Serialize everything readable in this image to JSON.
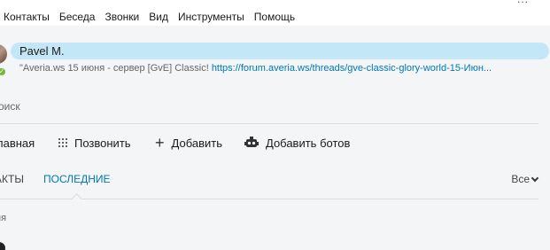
{
  "menubar": {
    "items": [
      "Контакты",
      "Беседа",
      "Звонки",
      "Вид",
      "Инструменты",
      "Помощь"
    ],
    "overflow": "..."
  },
  "profile": {
    "name": "Pavel M.",
    "mood_text": "\"Averia.ws 15 июня - сервер [GvE] Classic! ",
    "mood_link": "https://forum.averia.ws/threads/gve-classic-glory-world-15-Июн...",
    "presence": "online"
  },
  "search": {
    "placeholder": "Поиск",
    "visible_text": "оиск"
  },
  "actions": {
    "home": "лавная",
    "call": "Позвонить",
    "add": "Добавить",
    "bots": "Добавить ботов"
  },
  "tabs": {
    "contacts": "АКТЫ",
    "recent": "ПОСЛЕДНИЕ",
    "filter": "Все"
  },
  "list": {
    "section_label": "ня"
  },
  "colors": {
    "accent": "#0078b4",
    "pill": "#c4e7f8",
    "panel": "#f3f5f7",
    "online": "#6cbd2c"
  }
}
